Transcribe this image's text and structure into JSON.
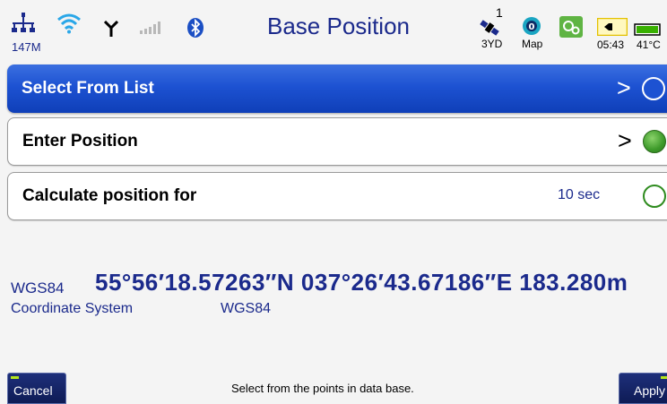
{
  "status_bar": {
    "network_label": "147M",
    "title": "Base Position",
    "satellite_count": "1",
    "fix_type": "3YD",
    "map_label": "Map",
    "time": "05:43",
    "temperature": "41°C",
    "icons": [
      "network-icon",
      "wifi-icon",
      "antenna-icon",
      "signal-bars-icon",
      "bluetooth-icon",
      "satellite-icon",
      "map-icon",
      "settings-icon",
      "speaker-icon",
      "battery-icon"
    ],
    "accent_color": "#1b2a8c"
  },
  "rows": [
    {
      "label": "Select From List",
      "trail": ">",
      "state": "selected-empty"
    },
    {
      "label": "Enter Position",
      "trail": ">",
      "state": "filled"
    },
    {
      "label": "Calculate position for",
      "trail": "10 sec",
      "state": "empty"
    }
  ],
  "position": {
    "datum": "WGS84",
    "coordinates": "55°56′18.57263″N 037°26′43.67186″E 183.280m",
    "coordinate_system_label": "Coordinate System",
    "coordinate_system_value": "WGS84"
  },
  "bottom_bar": {
    "cancel_label": "Cancel",
    "hint": "Select from the points in data base.",
    "apply_label": "Apply"
  }
}
